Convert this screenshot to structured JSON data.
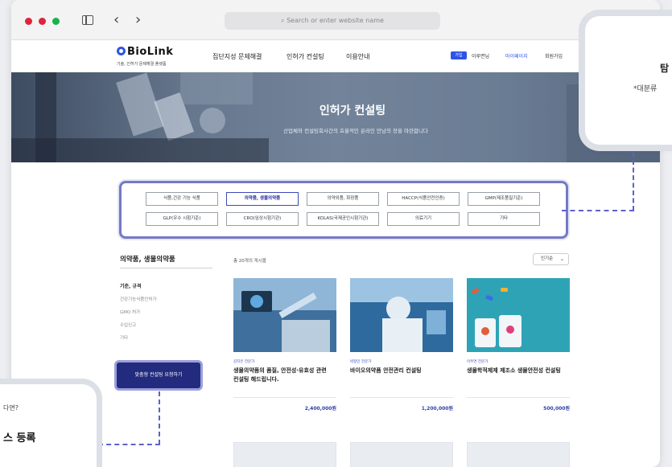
{
  "browser": {
    "url_placeholder": "Search or enter website name",
    "traffic_lights": [
      "#e0233f",
      "#e0233f",
      "#18b24a"
    ]
  },
  "header": {
    "logo": "BioLink",
    "logo_tagline": "기술, 인허가 문제해결 플랫폼",
    "nav": [
      "집단지성 문제해결",
      "인허가 컨설팅",
      "이용안내"
    ],
    "utility": {
      "login": "가입",
      "intro": "이루면님",
      "mypage": "마이페이지",
      "join": "회원가입"
    }
  },
  "hero": {
    "title": "인허가 컨설팅",
    "subtitle": "산업체와 컨설팅회사간의 효율적인 온라인 만남의 장을 마련합니다"
  },
  "categories": [
    {
      "label": "식품,건강 기능 식품",
      "active": false
    },
    {
      "label": "의약품, 생물의약품",
      "active": true
    },
    {
      "label": "의약외품, 화장품",
      "active": false
    },
    {
      "label": "HACCP(식품안전인증)",
      "active": false
    },
    {
      "label": "GMP(제조품질기준)",
      "active": false
    },
    {
      "label": "GLP(우수 시험기준)",
      "active": false
    },
    {
      "label": "CRO(임상시험기관)",
      "active": false
    },
    {
      "label": "KOLAS(국제공인시험기관)",
      "active": false
    },
    {
      "label": "의료기기",
      "active": false
    },
    {
      "label": "기타",
      "active": false
    }
  ],
  "sidebar": {
    "title": "의약품, 생물의약품",
    "section": "기준, 규격",
    "items": [
      "건강기능식품인허가",
      "GMO 허가",
      "수입신고",
      "기타"
    ],
    "request_button": "맞춤형 컨설팅 요청하기"
  },
  "listing": {
    "count": "총 20개의 게시물",
    "sort": "인기순",
    "cards": [
      {
        "category": "김지은 전문가",
        "title": "생물의약품의 품질, 안전성·유효성 관련 컨설팅 해드립니다.",
        "price": "2,400,000원"
      },
      {
        "category": "박정민 전문가",
        "title": "바이오의약품 안전관리 컨설팅",
        "price": "1,200,000원"
      },
      {
        "category": "이주연 전문가",
        "title": "생물학적제제 제조소 생물안전성 컨설팅",
        "price": "500,000원"
      }
    ]
  },
  "callouts": {
    "right_title": "탐",
    "right_note": "*대분류",
    "left_question": "다면?",
    "left_title": "스 등록"
  }
}
